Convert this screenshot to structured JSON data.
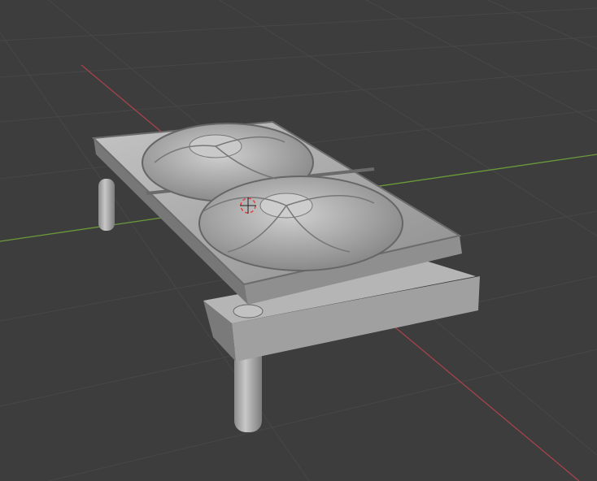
{
  "viewport": {
    "background_color": "#3d3d3d",
    "grid_color": "#474747",
    "x_axis_color": "#a8434a",
    "y_axis_color": "#6a9a3a",
    "model_color": "#a9a9a9"
  },
  "icons": {
    "cursor": "3d-cursor-icon"
  }
}
